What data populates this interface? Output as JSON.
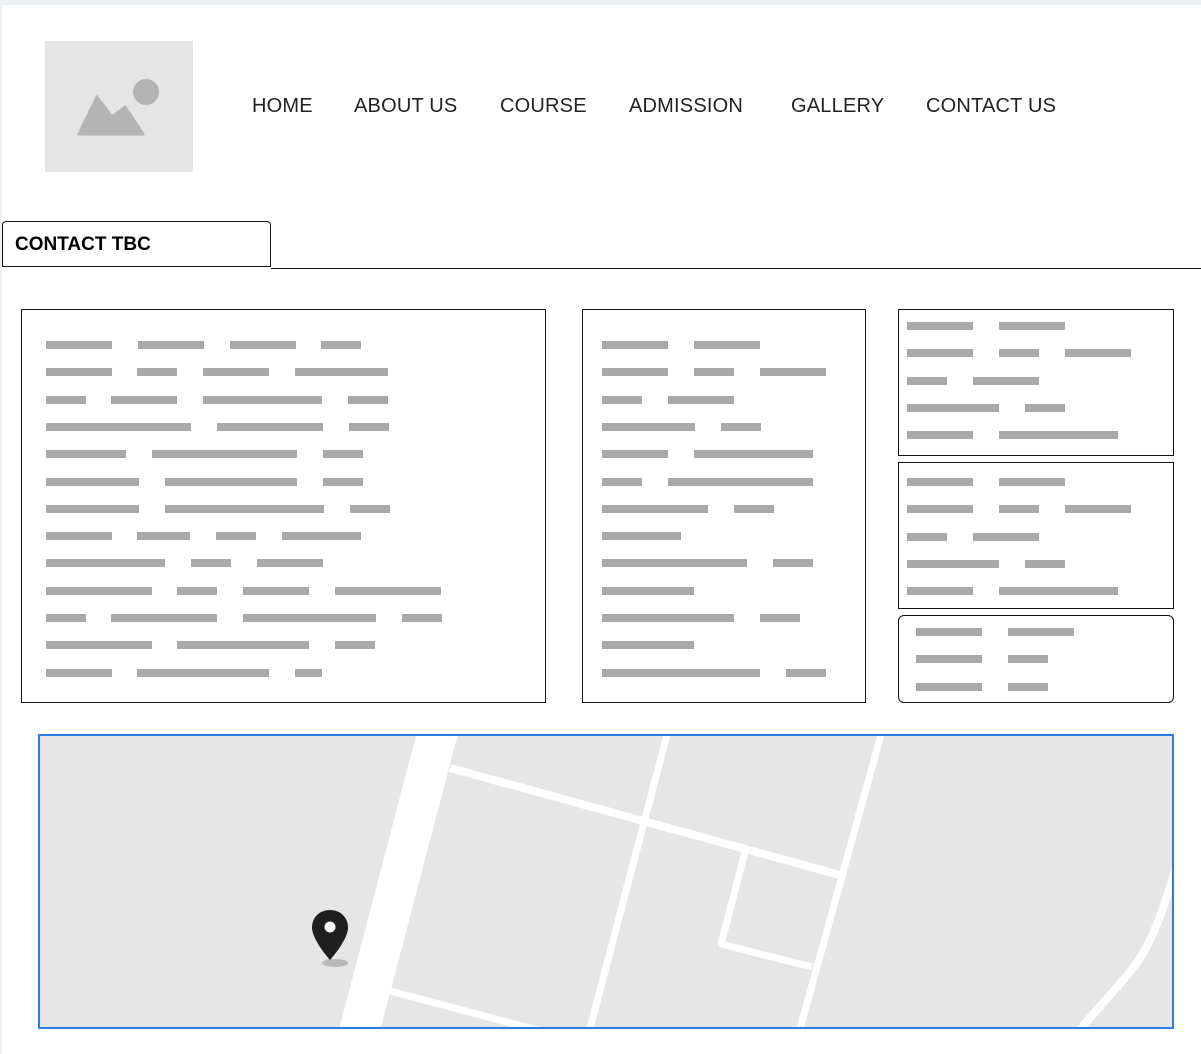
{
  "header": {
    "logo_icon": "image-placeholder-icon",
    "nav": [
      {
        "label": "HOME"
      },
      {
        "label": "ABOUT US"
      },
      {
        "label": "COURSE"
      },
      {
        "label": "ADMISSION"
      },
      {
        "label": "GALLERY"
      },
      {
        "label": "CONTACT US"
      }
    ]
  },
  "page_title": "CONTACT TBC",
  "map": {
    "marker_icon": "map-pin-icon",
    "accent_color": "#2b7de1"
  }
}
